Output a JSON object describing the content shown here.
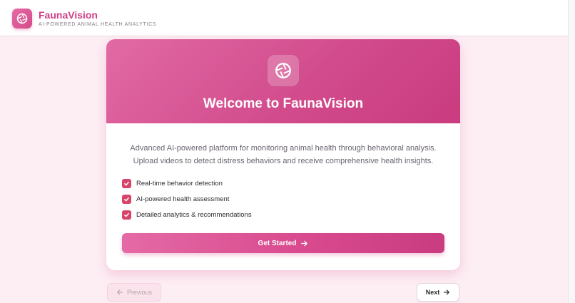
{
  "brand": {
    "name": "FaunaVision",
    "tagline": "AI-POWERED ANIMAL HEALTH ANALYTICS"
  },
  "welcome": {
    "title": "Welcome to FaunaVision",
    "description_line1": "Advanced AI-powered platform for monitoring animal health through behavioral analysis.",
    "description_line2": "Upload videos to detect distress behaviors and receive comprehensive health insights."
  },
  "features": [
    {
      "label": "Real-time behavior detection",
      "checked": true
    },
    {
      "label": "AI-powered health assessment",
      "checked": true
    },
    {
      "label": "Detailed analytics & recommendations",
      "checked": true
    }
  ],
  "cta": {
    "label": "Get Started"
  },
  "nav": {
    "previous_label": "Previous",
    "next_label": "Next"
  },
  "colors": {
    "accent": "#d64a8a",
    "check": "#d84469",
    "background": "#fdeef4"
  },
  "icons": {
    "logo": "aperture-icon",
    "check": "checkmark-icon",
    "arrow_right": "arrow-right-icon",
    "arrow_left": "arrow-left-icon"
  }
}
